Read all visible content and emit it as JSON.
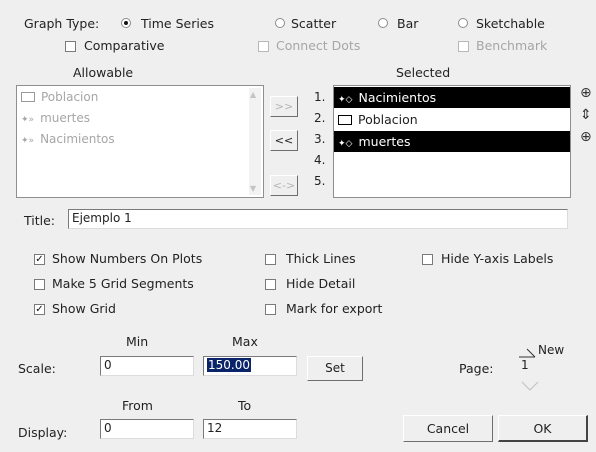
{
  "graph_type": {
    "label": "Graph Type:",
    "options": [
      {
        "label": "Time Series",
        "selected": true
      },
      {
        "label": "Scatter",
        "selected": false
      },
      {
        "label": "Bar",
        "selected": false
      },
      {
        "label": "Sketchable",
        "selected": false
      }
    ],
    "comparative": "Comparative",
    "connect_dots": "Connect Dots",
    "benchmark": "Benchmark"
  },
  "allowable": {
    "header": "Allowable",
    "items": [
      "Poblacion",
      "muertes",
      "Nacimientos"
    ]
  },
  "transfer": {
    "add": ">>",
    "remove": "<<",
    "swap": "<->"
  },
  "selected": {
    "header": "Selected",
    "slots": [
      "1.",
      "2.",
      "3.",
      "4.",
      "5."
    ],
    "items": [
      "Nacimientos",
      "Poblacion",
      "muertes"
    ]
  },
  "title": {
    "label": "Title:",
    "value": "Ejemplo 1"
  },
  "options": {
    "show_numbers": "Show Numbers On Plots",
    "make_5_grid": "Make 5 Grid Segments",
    "show_grid": "Show Grid",
    "thick_lines": "Thick Lines",
    "hide_detail": "Hide Detail",
    "mark_export": "Mark for export",
    "hide_y_axis": "Hide Y-axis Labels"
  },
  "scale": {
    "label": "Scale:",
    "min_header": "Min",
    "max_header": "Max",
    "min": "0",
    "max": "150.00",
    "set_button": "Set"
  },
  "display": {
    "label": "Display:",
    "from_header": "From",
    "to_header": "To",
    "from": "0",
    "to": "12"
  },
  "page": {
    "label": "Page:",
    "value": "1",
    "new_label": "New"
  },
  "buttons": {
    "cancel": "Cancel",
    "ok": "OK"
  }
}
